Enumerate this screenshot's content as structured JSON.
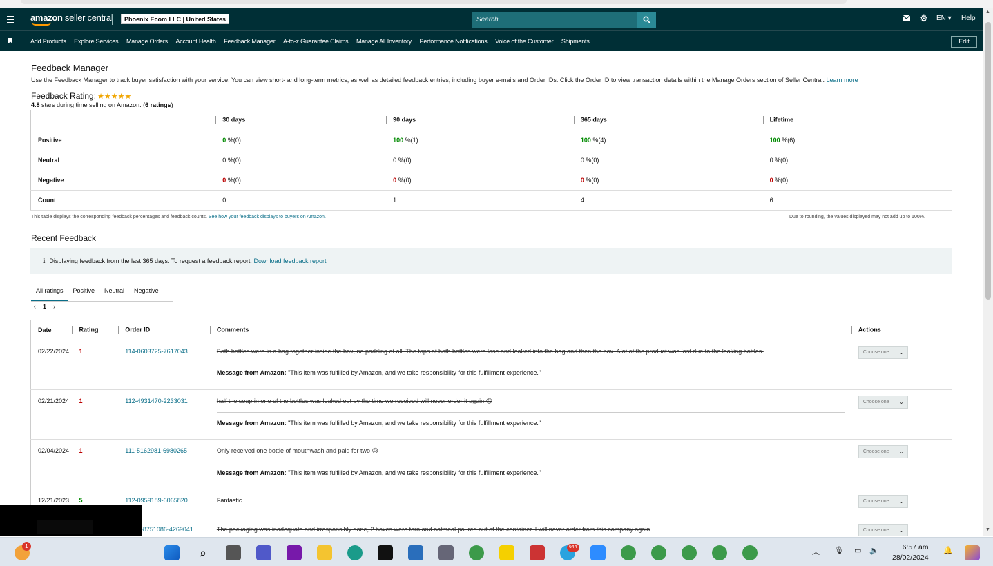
{
  "app": {
    "logo_main": "amazon",
    "logo_rest": " seller central",
    "account": "Phoenix Ecom LLC | United States",
    "search_placeholder": "Search",
    "lang": "EN",
    "help": "Help",
    "edit": "Edit"
  },
  "nav": [
    "Add Products",
    "Explore Services",
    "Manage Orders",
    "Account Health",
    "Feedback Manager",
    "A-to-z Guarantee Claims",
    "Manage All Inventory",
    "Performance Notifications",
    "Voice of the Customer",
    "Shipments"
  ],
  "page": {
    "title": "Feedback Manager",
    "description": "Use the Feedback Manager to track buyer satisfaction with your service. You can view short- and long-term metrics, as well as detailed feedback entries, including buyer e-mails and Order IDs. Click the Order ID to view transaction details within the Manage Orders section of Seller Central.",
    "learn_more": "Learn more",
    "rating_label": "Feedback Rating:",
    "stars": "★★★★★",
    "rating_value": "4.8",
    "rating_mid": " stars during time selling on Amazon. (",
    "rating_count": "6 ratings",
    "rating_end": ")"
  },
  "summary": {
    "headers": [
      "30 days",
      "90 days",
      "365 days",
      "Lifetime"
    ],
    "rows": [
      {
        "label": "Positive",
        "cells": [
          [
            "0",
            " %(0)"
          ],
          [
            "100",
            " %(1)"
          ],
          [
            "100",
            " %(4)"
          ],
          [
            "100",
            " %(6)"
          ]
        ]
      },
      {
        "label": "Neutral",
        "cells": [
          [
            "0",
            " %(0)"
          ],
          [
            "0",
            " %(0)"
          ],
          [
            "0",
            " %(0)"
          ],
          [
            "0",
            " %(0)"
          ]
        ]
      },
      {
        "label": "Negative",
        "cells": [
          [
            "0",
            " %(0)"
          ],
          [
            "0",
            " %(0)"
          ],
          [
            "0",
            " %(0)"
          ],
          [
            "0",
            " %(0)"
          ]
        ]
      },
      {
        "label": "Count",
        "cells": [
          [
            "0",
            ""
          ],
          [
            "1",
            ""
          ],
          [
            "4",
            ""
          ],
          [
            "6",
            ""
          ]
        ]
      }
    ],
    "note_left": "This table displays the corresponding feedback percentages and feedback counts.",
    "note_link": "See how your feedback displays to buyers on Amazon.",
    "note_right": "Due to rounding, the values displayed may not add up to 100%."
  },
  "recent": {
    "title": "Recent Feedback",
    "info": "Displaying feedback from the last 365 days. To request a feedback report:",
    "info_link": "Download feedback report",
    "tabs": [
      "All ratings",
      "Positive",
      "Neutral",
      "Negative"
    ],
    "page": "1",
    "headers": [
      "Date",
      "Rating",
      "Order ID",
      "Comments",
      "Actions"
    ],
    "msg_label": "Message from Amazon:",
    "msg_text": " \"This item was fulfilled by Amazon, and we take responsibility for this fulfillment experience.\"",
    "action_placeholder": "Choose one",
    "rows": [
      {
        "date": "02/22/2024",
        "rating": "1",
        "order": "114-0603725-7617043",
        "comment": "Both bottles were in a bag together inside the box, no padding at all. The tops of both bottles were lose and leaked into the bag and then the box. Alot of the product was lost due to the leaking bottles."
      },
      {
        "date": "02/21/2024",
        "rating": "1",
        "order": "112-4931470-2233031",
        "comment": "half the soap in one of the bottles was leaked out by the time we received will never order it again 😡"
      },
      {
        "date": "02/04/2024",
        "rating": "1",
        "order": "111-5162981-6980265",
        "comment": "Only received one bottle of mouthwash and paid for two 😓"
      },
      {
        "date": "12/21/2023",
        "rating": "5",
        "order": "112-0959189-6065820",
        "comment": "Fantastic"
      },
      {
        "date": "",
        "rating": "",
        "order": "2-8751086-4269041",
        "comment": "The packaging was inadequate and irresponsibly done, 2 boxes were torn and oatmeal poured out of the container. I will never order from this company again"
      }
    ]
  },
  "taskbar": {
    "time": "6:57 am",
    "date": "28/02/2024",
    "badge_weather": "1",
    "badge_telegram": "644"
  },
  "colors": {
    "header": "#002f36",
    "link": "#0a6e88",
    "positive": "#008a00",
    "negative": "#b00000",
    "star": "#f0a500"
  }
}
